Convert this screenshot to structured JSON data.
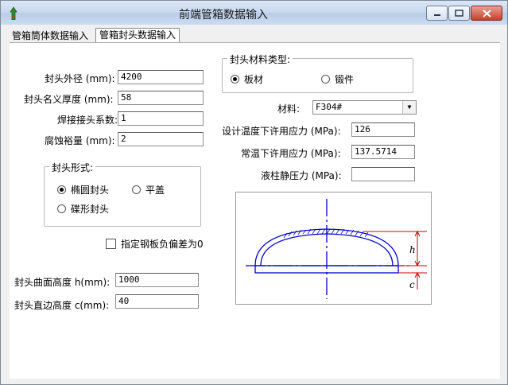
{
  "window": {
    "title": "前端管箱数据输入",
    "tabs": [
      "管箱筒体数据输入",
      "管箱封头数据输入"
    ]
  },
  "left": {
    "outer_diameter": {
      "label": "封头外径 (mm):",
      "value": "4200"
    },
    "nominal_thickness": {
      "label": "封头名义厚度 (mm):",
      "value": "58"
    },
    "weld_coefficient": {
      "label": "焊接接头系数:",
      "value": "1"
    },
    "corrosion_allowance": {
      "label": "腐蚀裕量 (mm):",
      "value": "2"
    },
    "head_form": {
      "title": "封头形式:",
      "options": [
        "椭圆封头",
        "平盖",
        "碟形封头"
      ],
      "selected": "椭圆封头"
    },
    "neg_deviation_checkbox": "指定钢板负偏差为0",
    "curve_height": {
      "label": "封头曲面高度 h(mm):",
      "value": "1000"
    },
    "straight_height": {
      "label": "封头直边高度 c(mm):",
      "value": "40"
    }
  },
  "right": {
    "material_type": {
      "title": "封头材料类型:",
      "options": [
        "板材",
        "锻件"
      ],
      "selected": "板材"
    },
    "material": {
      "label": "材料:",
      "value": "F304#"
    },
    "design_stress": {
      "label": "设计温度下许用应力 (MPa):",
      "value": "126"
    },
    "room_stress": {
      "label": "常温下许用应力 (MPa):",
      "value": "137.5714"
    },
    "liquid_pressure": {
      "label": "液柱静压力 (MPa):",
      "value": ""
    },
    "diagram_labels": {
      "h": "h",
      "c": "c"
    }
  },
  "colors": {
    "diagram_blue": "#0000cc",
    "diagram_red": "#cc0000"
  }
}
